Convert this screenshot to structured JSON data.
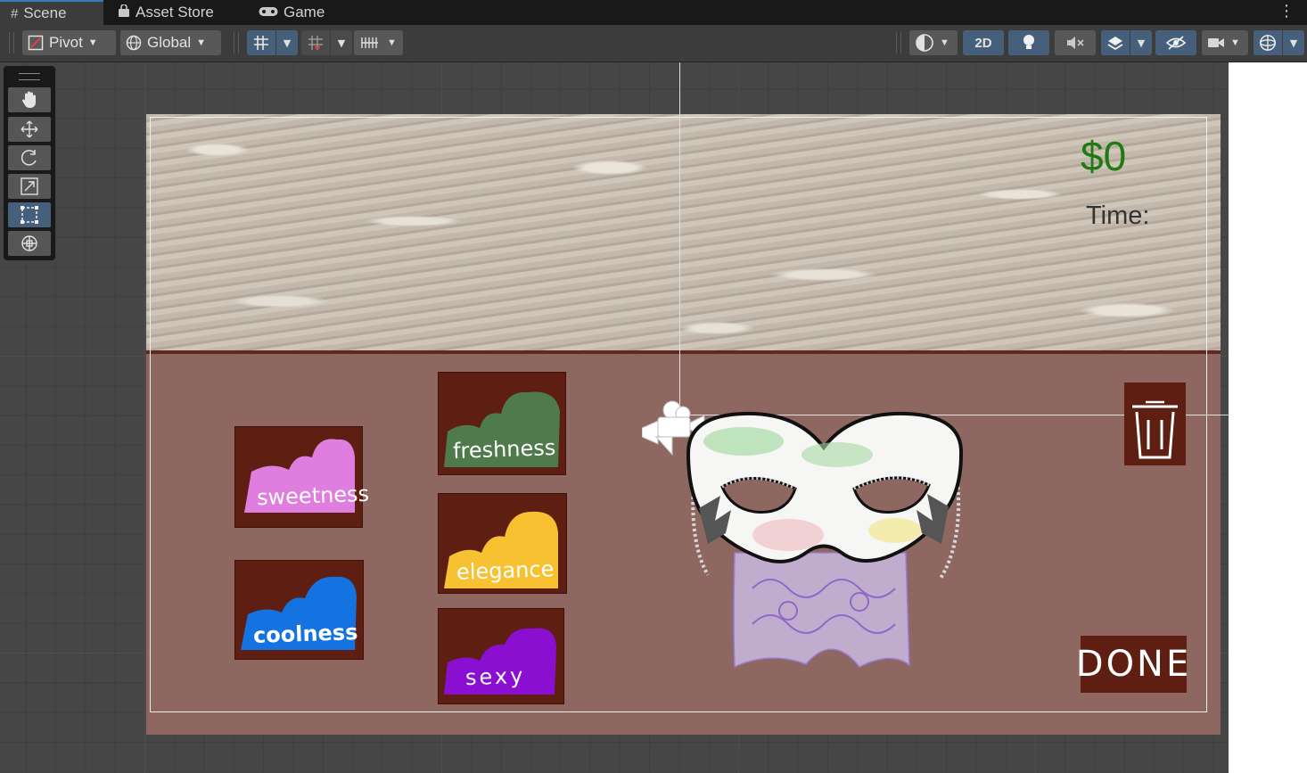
{
  "tabs": [
    {
      "label": "Scene",
      "icon": "grid-hash-icon"
    },
    {
      "label": "Asset Store",
      "icon": "store-bag-icon"
    },
    {
      "label": "Game",
      "icon": "gamepad-icon"
    }
  ],
  "toolbar": {
    "pivot_label": "Pivot",
    "global_label": "Global",
    "mode_2d_label": "2D"
  },
  "tools": [
    "hand-tool-icon",
    "move-tool-icon",
    "rotate-tool-icon",
    "scale-tool-icon",
    "rect-tool-icon",
    "transform-tool-icon"
  ],
  "game": {
    "money": "$0",
    "time_label": "Time:",
    "done_label": "DONE",
    "flavors": [
      {
        "label": "sweetness",
        "color": "#e07ee0"
      },
      {
        "label": "coolness",
        "color": "#1473e0"
      },
      {
        "label": "freshness",
        "color": "#4e7a4c"
      },
      {
        "label": "elegance",
        "color": "#f7c131"
      },
      {
        "label": "sexy",
        "color": "#8a0fd1"
      }
    ]
  },
  "colors": {
    "selected_blue": "#46607c",
    "wall_dark_red": "#5e1f12",
    "floor": "#8f6761",
    "money_green": "#1f7a12"
  }
}
